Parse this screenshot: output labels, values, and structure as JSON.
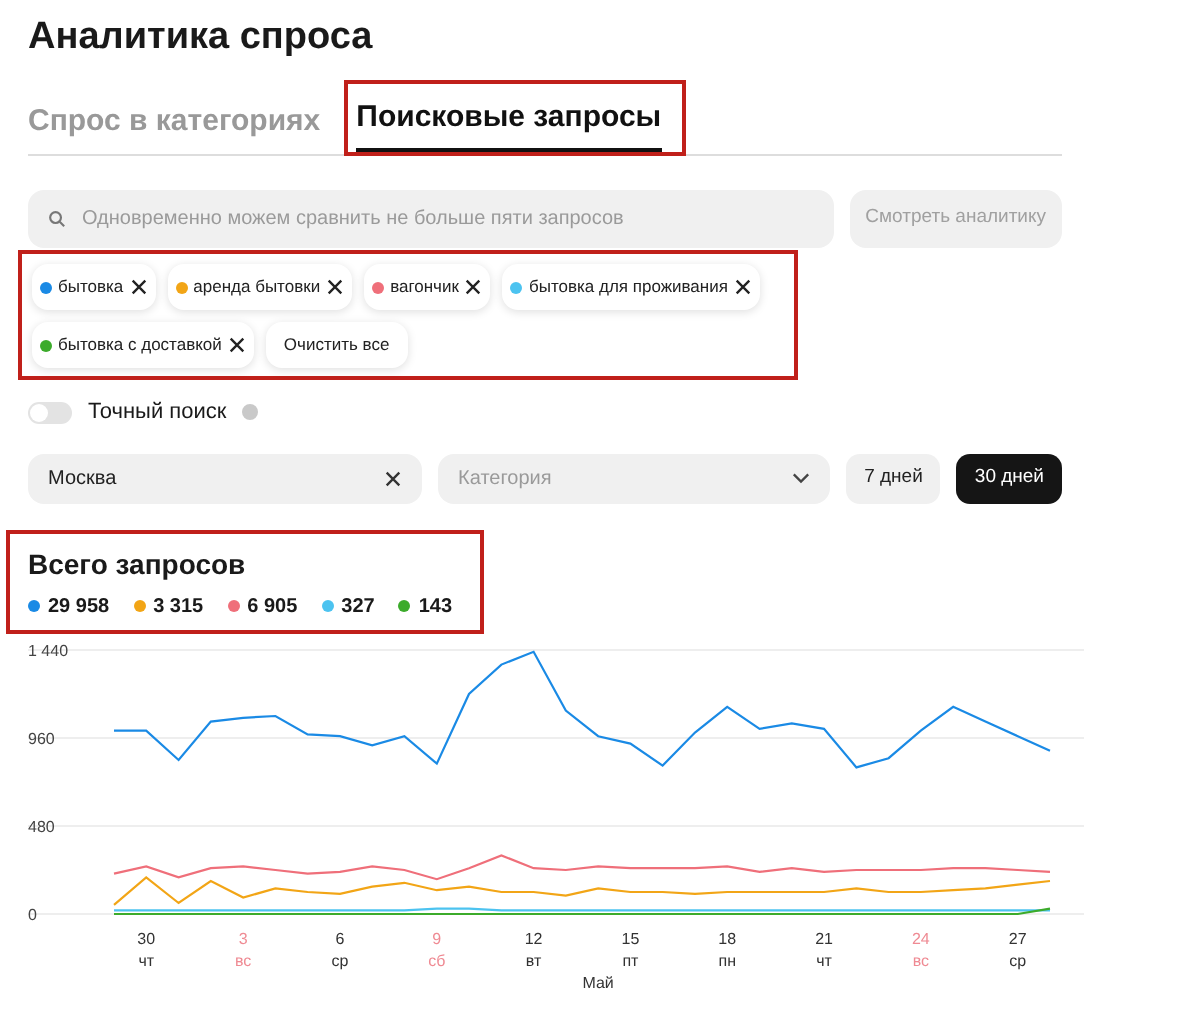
{
  "title": "Аналитика спроса",
  "tabs": [
    {
      "label": "Спрос в категориях",
      "selected": false,
      "highlighted": false
    },
    {
      "label": "Поисковые запросы",
      "selected": true,
      "highlighted": true
    }
  ],
  "search": {
    "placeholder": "Одновременно можем сравнить не больше пяти запросов"
  },
  "view_button": "Смотреть аналитику",
  "tags": [
    {
      "label": "бытовка",
      "color": "#1a8ae5"
    },
    {
      "label": "аренда бытовки",
      "color": "#f2a516"
    },
    {
      "label": "вагончик",
      "color": "#ef6f7a"
    },
    {
      "label": "бытовка для проживания",
      "color": "#4cc3f0"
    },
    {
      "label": "бытовка с доставкой",
      "color": "#3cab2b"
    }
  ],
  "clear_all": "Очистить все",
  "exact_search": {
    "label": "Точный поиск",
    "on": false
  },
  "region": {
    "value": "Москва"
  },
  "category": {
    "placeholder": "Категория"
  },
  "periods": [
    {
      "label": "7 дней",
      "selected": false
    },
    {
      "label": "30 дней",
      "selected": true
    }
  ],
  "totals_title": "Всего запросов",
  "totals": [
    {
      "value": "29 958",
      "color": "#1a8ae5"
    },
    {
      "value": "3 315",
      "color": "#f2a516"
    },
    {
      "value": "6 905",
      "color": "#ef6f7a"
    },
    {
      "value": "327",
      "color": "#4cc3f0"
    },
    {
      "value": "143",
      "color": "#3cab2b"
    }
  ],
  "chart": {
    "chart_data": {
      "type": "line",
      "xlabel": "Май",
      "ylim": [
        0,
        1440
      ],
      "categories": [
        null,
        "30",
        null,
        null,
        "3",
        null,
        null,
        "6",
        null,
        null,
        "9",
        null,
        null,
        "12",
        null,
        null,
        "15",
        null,
        null,
        "18",
        null,
        null,
        "21",
        null,
        null,
        "24",
        null,
        null,
        "27",
        null
      ],
      "yticks": [
        0,
        {
          "value": 480,
          "label": "480"
        },
        {
          "value": 960,
          "label": "960"
        },
        {
          "value": 1440,
          "label": "1 440"
        }
      ],
      "series": [
        {
          "color": "#1a8ae5",
          "values": [
            1000,
            1000,
            840,
            1050,
            1070,
            1080,
            980,
            970,
            920,
            970,
            820,
            1200,
            1360,
            1430,
            1110,
            970,
            930,
            810,
            990,
            1130,
            1010,
            1040,
            1010,
            800,
            850,
            1000,
            1130,
            1050,
            970,
            890
          ]
        },
        {
          "color": "#f2a516",
          "values": [
            50,
            200,
            60,
            180,
            90,
            140,
            120,
            110,
            150,
            170,
            130,
            150,
            120,
            120,
            100,
            140,
            120,
            120,
            110,
            120,
            120,
            120,
            120,
            140,
            120,
            120,
            130,
            140,
            160,
            180
          ]
        },
        {
          "color": "#ef6f7a",
          "values": [
            220,
            260,
            200,
            250,
            260,
            240,
            220,
            230,
            260,
            240,
            190,
            250,
            320,
            250,
            240,
            260,
            250,
            250,
            250,
            260,
            230,
            250,
            230,
            240,
            240,
            240,
            250,
            250,
            240,
            230
          ]
        },
        {
          "color": "#4cc3f0",
          "values": [
            20,
            20,
            20,
            20,
            20,
            20,
            20,
            20,
            20,
            20,
            30,
            30,
            20,
            20,
            20,
            20,
            20,
            20,
            20,
            20,
            20,
            20,
            20,
            20,
            20,
            20,
            20,
            20,
            20,
            20
          ]
        },
        {
          "color": "#3cab2b",
          "values": [
            0,
            0,
            0,
            0,
            0,
            0,
            0,
            0,
            0,
            0,
            0,
            0,
            0,
            0,
            0,
            0,
            0,
            0,
            0,
            0,
            0,
            0,
            0,
            0,
            0,
            0,
            0,
            0,
            0,
            30
          ]
        }
      ]
    },
    "weekdays": [
      {
        "label": "чт",
        "weekend": false
      },
      {
        "label": "вс",
        "weekend": true
      },
      {
        "label": "ср",
        "weekend": false
      },
      {
        "label": "сб",
        "weekend": true
      },
      {
        "label": "вт",
        "weekend": false
      },
      {
        "label": "пт",
        "weekend": false
      },
      {
        "label": "пн",
        "weekend": false
      },
      {
        "label": "чт",
        "weekend": false
      },
      {
        "label": "вс",
        "weekend": true
      },
      {
        "label": "ср",
        "weekend": false
      }
    ]
  }
}
